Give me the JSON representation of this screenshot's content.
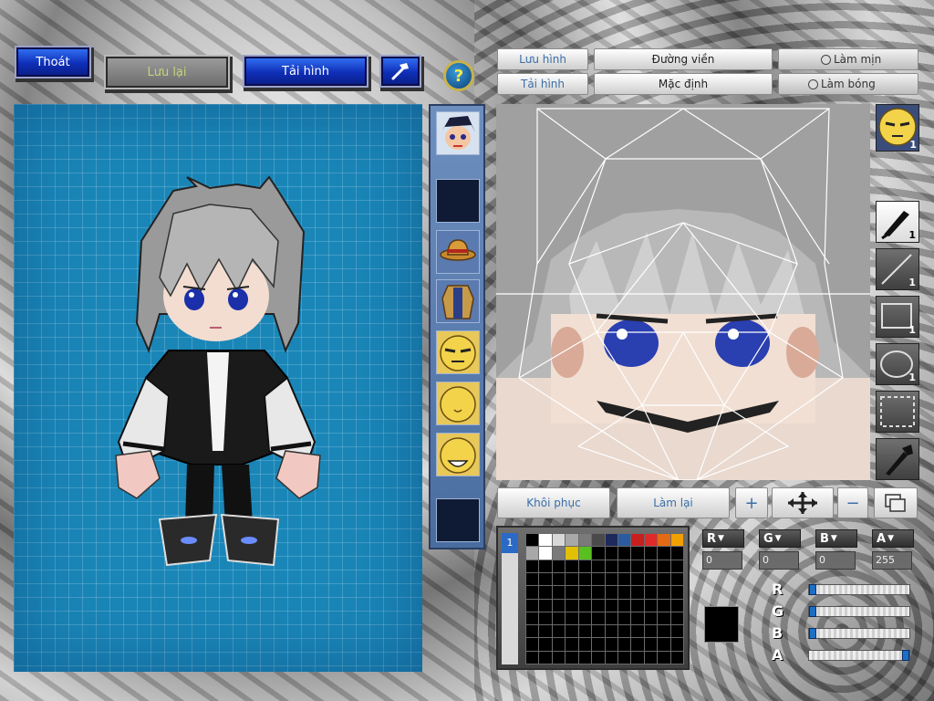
{
  "top_left": {
    "exit_label": "Thoát",
    "save_label": "Lưu lại",
    "reload_label": "Tải hình"
  },
  "editor_header": {
    "save_image_label": "Lưu hình",
    "load_image_label": "Tải hình",
    "outline_label": "Đường viền",
    "default_label": "Mặc định",
    "smooth_label": "Làm mịn",
    "shade_label": "Làm bóng"
  },
  "editor_actions": {
    "restore_label": "Khôi phục",
    "redo_label": "Làm lại"
  },
  "tools": [
    {
      "icon": "brush-icon",
      "count": "1"
    },
    {
      "icon": "line-icon",
      "count": "1"
    },
    {
      "icon": "rectangle-icon",
      "count": "1"
    },
    {
      "icon": "ellipse-icon",
      "count": "1"
    },
    {
      "icon": "selection-icon",
      "count": ""
    },
    {
      "icon": "eyedropper-icon",
      "count": ""
    }
  ],
  "face_tab_count": "1",
  "layer_index": "1",
  "color": {
    "channel_labels": [
      "R",
      "G",
      "B",
      "A"
    ],
    "r": "0",
    "g": "0",
    "b": "0",
    "a": "255",
    "current": "#000000",
    "slider_levels": {
      "R": 0,
      "G": 0,
      "B": 0,
      "A": 1
    }
  },
  "palette_row1": [
    "#000000",
    "#ffffff",
    "#d8d8d8",
    "#a8a8a8",
    "#7a7a7a",
    "#4a4a4a",
    "#1e2a5a",
    "#2a5aa0",
    "#c81e1e",
    "#e02a2a",
    "#e26a14",
    "#f0a000"
  ],
  "palette_row2": [
    "#a8a8a8",
    "#ffffff",
    "#7a7a7a",
    "#e0c000",
    "#58c020"
  ],
  "accent": {
    "blue_button": "#1a3fd0",
    "canvas": "#1a86b8"
  }
}
